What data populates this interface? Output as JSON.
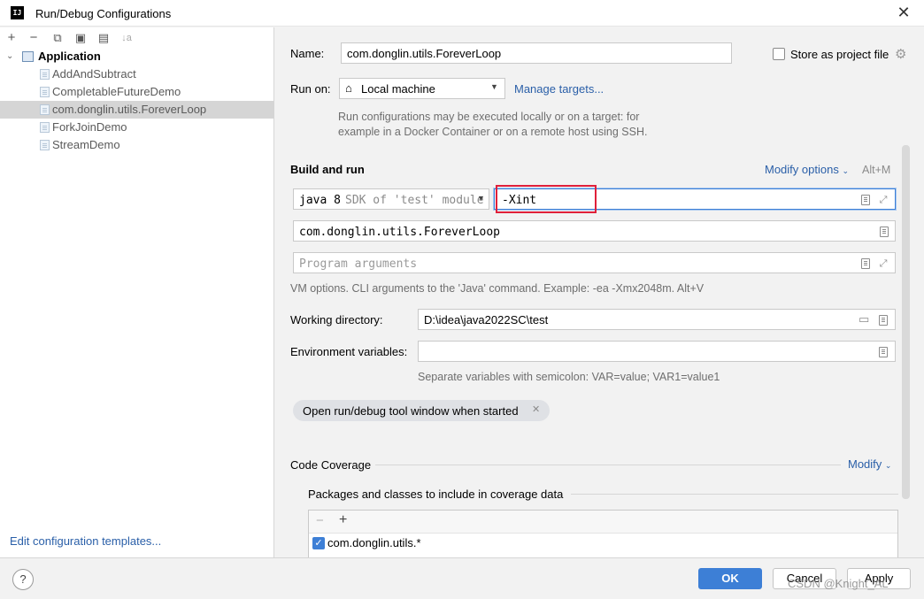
{
  "window": {
    "title": "Run/Debug Configurations",
    "logo_text": "IJ"
  },
  "toolbar": {
    "add": "+",
    "remove": "−",
    "copy": "⧉",
    "save": "▣",
    "folder": "▤",
    "sort": "↓a"
  },
  "tree": {
    "root": "Application",
    "items": [
      {
        "label": "AddAndSubtract"
      },
      {
        "label": "CompletableFutureDemo"
      },
      {
        "label": "com.donglin.utils.ForeverLoop",
        "selected": true
      },
      {
        "label": "ForkJoinDemo"
      },
      {
        "label": "StreamDemo"
      }
    ]
  },
  "left_footer": {
    "edit_templates": "Edit configuration templates..."
  },
  "form": {
    "name_label": "Name:",
    "name_value": "com.donglin.utils.ForeverLoop",
    "store_label": "Store as project file",
    "run_on_label": "Run on:",
    "run_on_value": "Local machine",
    "manage_targets": "Manage targets...",
    "run_on_hint_1": "Run configurations may be executed locally or on a target: for",
    "run_on_hint_2": "example in a Docker Container or on a remote host using SSH.",
    "build_run_title": "Build and run",
    "modify_options": "Modify options",
    "modify_shortcut": "Alt+M",
    "sdk_main": "java 8",
    "sdk_hint": "SDK of 'test' module",
    "vm_options": "-Xint",
    "main_class": "com.donglin.utils.ForeverLoop",
    "program_args_placeholder": "Program arguments",
    "vm_hint": "VM options. CLI arguments to the 'Java' command. Example: -ea -Xmx2048m. Alt+V",
    "working_dir_label": "Working directory:",
    "working_dir_value": "D:\\idea\\java2022SC\\test",
    "env_label": "Environment variables:",
    "env_hint": "Separate variables with semicolon: VAR=value; VAR1=value1",
    "tag_open_tool": "Open run/debug tool window when started",
    "code_coverage": "Code Coverage",
    "modify": "Modify",
    "packages_title": "Packages and classes to include in coverage data",
    "coverage_item": "com.donglin.utils.*"
  },
  "buttons": {
    "help": "?",
    "ok": "OK",
    "cancel": "Cancel",
    "apply": "Apply"
  },
  "watermark": "CSDN @Knight_AL",
  "colors": {
    "accent": "#3d7fd6",
    "link": "#2a5fa8",
    "highlight_box": "#e0203a",
    "selection": "#d5d5d5"
  }
}
